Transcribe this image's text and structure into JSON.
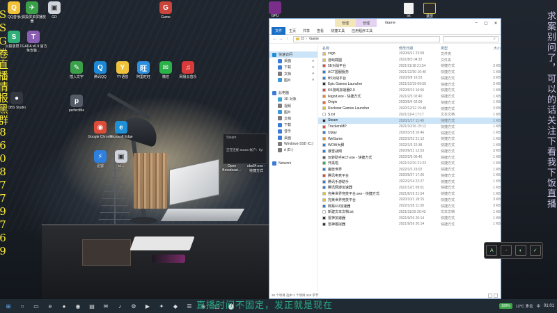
{
  "desktop_icons": [
    {
      "label": "QQ音乐",
      "glyph": "Q",
      "color": "#f0c23c"
    },
    {
      "label": "火狐投屏多屏播放器",
      "glyph": "✈",
      "color": "#3aa14a"
    },
    {
      "label": "GD",
      "glyph": "▣",
      "color": "#cfd4dc"
    },
    {
      "label": "Game",
      "glyph": "G",
      "color": "#c9443b"
    },
    {
      "label": "火狐录屏…",
      "glyph": "S",
      "color": "#2fae7a"
    },
    {
      "label": "TGADA v0.9 官方免安装…",
      "glyph": "T",
      "color": "#8a5fb3"
    },
    {
      "label": "插入文字",
      "glyph": "✎",
      "color": "#3aa14a"
    },
    {
      "label": "腾讯QQ",
      "glyph": "Q",
      "color": "#1d89d6"
    },
    {
      "label": "YY语音",
      "glyph": "Y",
      "color": "#f0c23c"
    },
    {
      "label": "阿里旺旺",
      "glyph": "旺",
      "color": "#2d8fe0"
    },
    {
      "label": "微信",
      "glyph": "✉",
      "color": "#2bb04a"
    },
    {
      "label": "网易云音乐",
      "glyph": "♫",
      "color": "#d93a3a"
    },
    {
      "label": "OBS Studio",
      "glyph": "●",
      "color": "#333740"
    },
    {
      "label": "perfectMe",
      "glyph": "p",
      "color": "#555b66"
    },
    {
      "label": "Google Chrome",
      "glyph": "◉",
      "color": "#dd4b39"
    },
    {
      "label": "Microsoft Edge",
      "glyph": "e",
      "color": "#1f8fd6"
    },
    {
      "label": "迅雷",
      "glyph": "⚡",
      "color": "#2d7fe0"
    },
    {
      "label": "d…",
      "glyph": "▣",
      "color": "#cfd4dc"
    }
  ],
  "overlay_left": "SSG卷直播情报黑群8608779769",
  "overlay_right": "求案别问了，可以的话关注下看我下饭直播",
  "corner_icons": [
    "GPU",
    "txt",
    "录屏"
  ],
  "explorer": {
    "title": "Game",
    "context_tabs": [
      "管理",
      "管理"
    ],
    "ribbon_tabs": [
      "文件",
      "主页",
      "共享",
      "查看",
      "快捷工具",
      "应用程序工具"
    ],
    "path": [
      "D",
      "Game"
    ],
    "nav_items": [
      {
        "label": "快速访问",
        "color": "#1f8fd6",
        "pin": false,
        "selected": true
      },
      {
        "label": "桌面",
        "color": "#3a7bd5",
        "pin": true,
        "selected": false
      },
      {
        "label": "下载",
        "color": "#3a7bd5",
        "pin": true,
        "selected": false
      },
      {
        "label": "文档",
        "color": "#7a7a7a",
        "pin": true,
        "selected": false
      },
      {
        "label": "图片",
        "color": "#3a9ad5",
        "pin": true,
        "selected": false
      },
      {
        "label": "",
        "color": "#ffffff",
        "pin": false,
        "selected": false
      },
      {
        "label": "此电脑",
        "color": "#3a7bd5",
        "pin": false,
        "selected": false
      },
      {
        "label": "3D 对象",
        "color": "#3aa6d5",
        "pin": false,
        "selected": false
      },
      {
        "label": "视频",
        "color": "#7a7a7a",
        "pin": false,
        "selected": false
      },
      {
        "label": "图片",
        "color": "#3a9ad5",
        "pin": false,
        "selected": false
      },
      {
        "label": "文档",
        "color": "#7a7a7a",
        "pin": false,
        "selected": false
      },
      {
        "label": "下载",
        "color": "#3a7bd5",
        "pin": false,
        "selected": false
      },
      {
        "label": "音乐",
        "color": "#3a7bd5",
        "pin": false,
        "selected": false
      },
      {
        "label": "桌面",
        "color": "#3a7bd5",
        "pin": false,
        "selected": false
      },
      {
        "label": "Windows-SSD (C:)",
        "color": "#7a7a7a",
        "pin": false,
        "selected": false
      },
      {
        "label": "d (D:)",
        "color": "#7a7a7a",
        "pin": false,
        "selected": false
      },
      {
        "label": "",
        "color": "#ffffff",
        "pin": false,
        "selected": false
      },
      {
        "label": "Network",
        "color": "#3a7bd5",
        "pin": false,
        "selected": false
      }
    ],
    "columns": {
      "name": "名称",
      "date": "修改日期",
      "type": "类型",
      "size": "大小"
    },
    "files": [
      {
        "name": "csgo",
        "date": "2020/6/21 23:09",
        "type": "文件夹",
        "size": "",
        "color": "#e8c15a",
        "selected": false
      },
      {
        "name": "游戏截图",
        "date": "2021/8/3 04:32",
        "type": "文件夹",
        "size": "",
        "color": "#e8c15a",
        "selected": false
      },
      {
        "name": "5E对战平台",
        "date": "2021/11/18 21:54",
        "type": "快捷方式",
        "size": "3 KB",
        "color": "#d44",
        "selected": false
      },
      {
        "name": "ACT国服服务",
        "date": "2021/12/30 10:40",
        "type": "快捷方式",
        "size": "1 KB",
        "color": "#2c7cd4",
        "selected": false
      },
      {
        "name": "B5对战平台",
        "date": "2020/5/8 16:53",
        "type": "快捷方式",
        "size": "3 KB",
        "color": "#2c7cd4",
        "selected": false
      },
      {
        "name": "Epic Games Launcher",
        "date": "2021/12/19 09:50",
        "type": "快捷方式",
        "size": "3 KB",
        "color": "#333",
        "selected": false
      },
      {
        "name": "KK游戏加速器2.0",
        "date": "2020/6/13 16:56",
        "type": "快捷方式",
        "size": "1 KB",
        "color": "#d44",
        "selected": false
      },
      {
        "name": "leigod.exe - 快捷方式",
        "date": "2021/2/3 02:40",
        "type": "快捷方式",
        "size": "1 KB",
        "color": "#e88a2c",
        "selected": false
      },
      {
        "name": "Origin",
        "date": "2020/6/4 02:09",
        "type": "快捷方式",
        "size": "1 KB",
        "color": "#e8662c",
        "selected": false
      },
      {
        "name": "Rockstar Games Launcher",
        "date": "2020/12/12 19:48",
        "type": "快捷方式",
        "size": "3 KB",
        "color": "#e8c12c",
        "selected": false
      },
      {
        "name": "S.txt",
        "date": "2021/11/4 17:17",
        "type": "文本文档",
        "size": "1 KB",
        "color": "#ffffff",
        "selected": false
      },
      {
        "name": "Steam",
        "date": "2020/1/17 11:49",
        "type": "快捷方式",
        "size": "1 KB",
        "color": "#1b2838",
        "selected": true
      },
      {
        "name": "TruckersMP",
        "date": "2021/10/16 15:12",
        "type": "快捷方式",
        "size": "1 KB",
        "color": "#d44",
        "selected": false
      },
      {
        "name": "Uplay",
        "date": "2020/3/18 16:46",
        "type": "快捷方式",
        "size": "1 KB",
        "color": "#2c7cd4",
        "selected": false
      },
      {
        "name": "WeGame",
        "date": "2022/2/23 21:12",
        "type": "快捷方式",
        "size": "1 KB",
        "color": "#e88a2c",
        "selected": false
      },
      {
        "name": "WOW大脚",
        "date": "2022/1/3 22:38",
        "type": "快捷方式",
        "size": "1 KB",
        "color": "#2c7cd4",
        "selected": false
      },
      {
        "name": "暴雪战网",
        "date": "2020/6/21 12:53",
        "type": "快捷方式",
        "size": "3 KB",
        "color": "#2c7cd4",
        "selected": false
      },
      {
        "name": "玩转助手ACT.exe - 快捷方式",
        "date": "2022/2/6 00:46",
        "type": "快捷方式",
        "size": "1 KB",
        "color": "#555",
        "selected": false
      },
      {
        "name": "开黑啦",
        "date": "2021/12/10 21:23",
        "type": "快捷方式",
        "size": "1 KB",
        "color": "#2bb04a",
        "selected": false
      },
      {
        "name": "魔兽世界",
        "date": "2022/1/2 23:02",
        "type": "快捷方式",
        "size": "1 KB",
        "color": "#2c7cd4",
        "selected": false
      },
      {
        "name": "腾讯电竞平台",
        "date": "2020/5/27 17:26",
        "type": "快捷方式",
        "size": "1 KB",
        "color": "#d44",
        "selected": false
      },
      {
        "name": "腾讯手游助手",
        "date": "2022/2/14 22:27",
        "type": "快捷方式",
        "size": "1 KB",
        "color": "#2c7cd4",
        "selected": false
      },
      {
        "name": "腾讯网游加速器",
        "date": "2021/12/1 09:01",
        "type": "快捷方式",
        "size": "1 KB",
        "color": "#2c7cd4",
        "selected": false
      },
      {
        "name": "完美世界竞技平台.exe - 快捷方式",
        "date": "2021/6/19 21:54",
        "type": "快捷方式",
        "size": "1 KB",
        "color": "#e8c12c",
        "selected": false
      },
      {
        "name": "完美世界竞技平台",
        "date": "2020/10/1 18:15",
        "type": "快捷方式",
        "size": "3 KB",
        "color": "#e8c12c",
        "selected": false
      },
      {
        "name": "网易UU加速器",
        "date": "2022/1/28 11:39",
        "type": "快捷方式",
        "size": "3 KB",
        "color": "#2c7cd4",
        "selected": false
      },
      {
        "name": "新建文本文档.txt",
        "date": "2021/11/29 20:43",
        "type": "文本文档",
        "size": "1 KB",
        "color": "#ffffff",
        "selected": false
      },
      {
        "name": "雷神加速器",
        "date": "2021/9/26 20:14",
        "type": "快捷方式",
        "size": "1 KB",
        "color": "#333",
        "selected": false
      },
      {
        "name": "雷神模拟器",
        "date": "2021/9/26 20:14",
        "type": "快捷方式",
        "size": "1 KB",
        "color": "#333",
        "selected": false
      }
    ],
    "status": "29 个项目   选中 1 个项目  349 字节"
  },
  "steam_popup": {
    "title": "Steam",
    "body": "正在连接 Steam 帐户：flyi"
  },
  "shortcuts": [
    {
      "label": "Open Broadcast…"
    },
    {
      "label": "obs64.exe - 快捷方式"
    }
  ],
  "floatbar": [
    "A",
    "-",
    "◐",
    "✓"
  ],
  "taskbar": {
    "apps": [
      "⊞",
      "○",
      "▭",
      "e",
      "●",
      "◉",
      "▤",
      "✉",
      "♪",
      "⚙",
      "▶",
      "✦",
      "◆",
      "☰",
      "◈",
      "▢",
      "⬤"
    ],
    "battery": "100%",
    "weather": "12°C 多云",
    "lang": "中",
    "time": "01:01"
  },
  "banner_text": "直播时间不固定，发正就是现在"
}
